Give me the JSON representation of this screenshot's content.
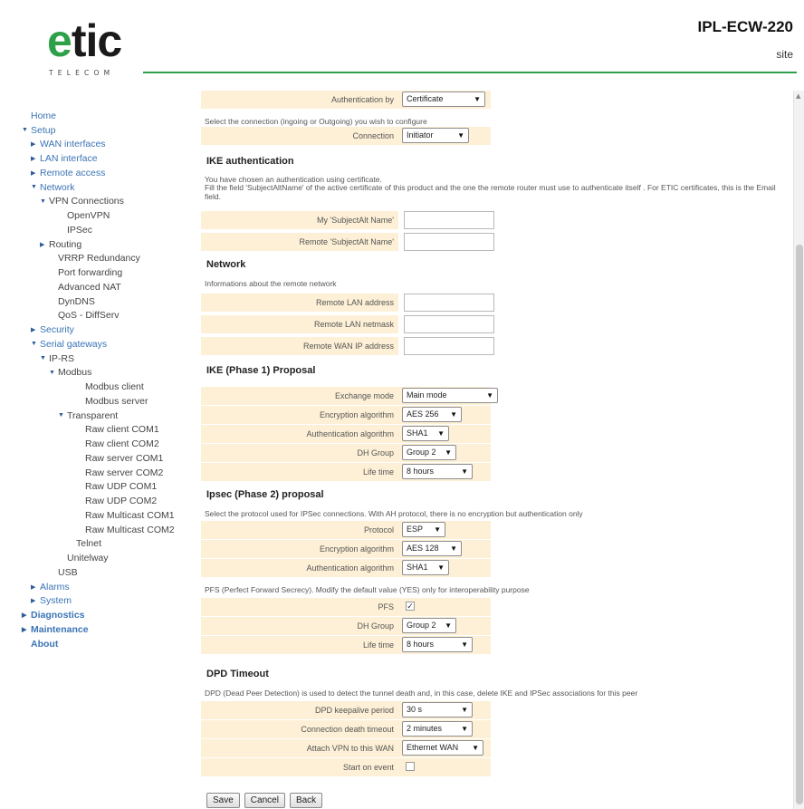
{
  "header": {
    "logo_main": "tic",
    "logo_e": "e",
    "logo_sub": "TELECOM",
    "product_title": "IPL-ECW-220",
    "product_sub": "site"
  },
  "sidebar": [
    {
      "label": "Home",
      "indent": 0,
      "tri": "",
      "cls": "link"
    },
    {
      "label": "Setup",
      "indent": 0,
      "tri": "▼",
      "cls": "link"
    },
    {
      "label": "WAN interfaces",
      "indent": 1,
      "tri": "▶",
      "cls": "link"
    },
    {
      "label": "LAN interface",
      "indent": 1,
      "tri": "▶",
      "cls": "link"
    },
    {
      "label": "Remote access",
      "indent": 1,
      "tri": "▶",
      "cls": "link"
    },
    {
      "label": "Network",
      "indent": 1,
      "tri": "▼",
      "cls": "link"
    },
    {
      "label": "VPN Connections",
      "indent": 2,
      "tri": "▼",
      "cls": ""
    },
    {
      "label": "OpenVPN",
      "indent": 4,
      "tri": "",
      "cls": ""
    },
    {
      "label": "IPSec",
      "indent": 4,
      "tri": "",
      "cls": ""
    },
    {
      "label": "Routing",
      "indent": 2,
      "tri": "▶",
      "cls": ""
    },
    {
      "label": "VRRP Redundancy",
      "indent": 3,
      "tri": "",
      "cls": ""
    },
    {
      "label": "Port forwarding",
      "indent": 3,
      "tri": "",
      "cls": ""
    },
    {
      "label": "Advanced NAT",
      "indent": 3,
      "tri": "",
      "cls": ""
    },
    {
      "label": "DynDNS",
      "indent": 3,
      "tri": "",
      "cls": ""
    },
    {
      "label": "QoS - DiffServ",
      "indent": 3,
      "tri": "",
      "cls": ""
    },
    {
      "label": "Security",
      "indent": 1,
      "tri": "▶",
      "cls": "link"
    },
    {
      "label": "Serial gateways",
      "indent": 1,
      "tri": "▼",
      "cls": "link"
    },
    {
      "label": "IP-RS",
      "indent": 2,
      "tri": "▼",
      "cls": ""
    },
    {
      "label": "Modbus",
      "indent": 3,
      "tri": "▼",
      "cls": ""
    },
    {
      "label": "Modbus client",
      "indent": 6,
      "tri": "",
      "cls": ""
    },
    {
      "label": "Modbus server",
      "indent": 6,
      "tri": "",
      "cls": ""
    },
    {
      "label": "Transparent",
      "indent": 4,
      "tri": "▼",
      "cls": ""
    },
    {
      "label": "Raw client COM1",
      "indent": 6,
      "tri": "",
      "cls": ""
    },
    {
      "label": "Raw client COM2",
      "indent": 6,
      "tri": "",
      "cls": ""
    },
    {
      "label": "Raw server COM1",
      "indent": 6,
      "tri": "",
      "cls": ""
    },
    {
      "label": "Raw server COM2",
      "indent": 6,
      "tri": "",
      "cls": ""
    },
    {
      "label": "Raw UDP COM1",
      "indent": 6,
      "tri": "",
      "cls": ""
    },
    {
      "label": "Raw UDP COM2",
      "indent": 6,
      "tri": "",
      "cls": ""
    },
    {
      "label": "Raw Multicast COM1",
      "indent": 6,
      "tri": "",
      "cls": ""
    },
    {
      "label": "Raw Multicast COM2",
      "indent": 6,
      "tri": "",
      "cls": ""
    },
    {
      "label": "Telnet",
      "indent": 5,
      "tri": "",
      "cls": ""
    },
    {
      "label": "Unitelway",
      "indent": 4,
      "tri": "",
      "cls": ""
    },
    {
      "label": "USB",
      "indent": 3,
      "tri": "",
      "cls": ""
    },
    {
      "label": "Alarms",
      "indent": 1,
      "tri": "▶",
      "cls": "link"
    },
    {
      "label": "System",
      "indent": 1,
      "tri": "▶",
      "cls": "link"
    },
    {
      "label": "Diagnostics",
      "indent": 0,
      "tri": "▶",
      "cls": "link bold"
    },
    {
      "label": "Maintenance",
      "indent": 0,
      "tri": "▶",
      "cls": "link bold"
    },
    {
      "label": "About",
      "indent": 0,
      "tri": "",
      "cls": "link bold"
    }
  ],
  "form": {
    "auth_by_label": "Authentication by",
    "auth_by_value": "Certificate",
    "connection_info": "Select the connection (ingoing or Outgoing) you wish to configure",
    "connection_label": "Connection",
    "connection_value": "Initiator",
    "ike_auth_title": "IKE authentication",
    "ike_auth_info_1": "You have chosen an authentication using certificate.",
    "ike_auth_info_2": "Fill the field 'SubjectAltName' of the active certificate of this product and the one the remote router must use to authenticate itself . For ETIC certificates, this is the Email field.",
    "my_san_label": "My 'SubjectAlt Name'",
    "remote_san_label": "Remote 'SubjectAlt Name'",
    "network_title": "Network",
    "network_info": "Informations about the remote network",
    "remote_lan_address_label": "Remote LAN address",
    "remote_lan_netmask_label": "Remote LAN netmask",
    "remote_wan_ip_label": "Remote WAN IP address",
    "ike_p1_title": "IKE (Phase 1) Proposal",
    "exchange_mode_label": "Exchange mode",
    "exchange_mode_value": "Main mode",
    "p1_enc_label": "Encryption algorithm",
    "p1_enc_value": "AES 256",
    "p1_auth_label": "Authentication algorithm",
    "p1_auth_value": "SHA1",
    "p1_dh_label": "DH Group",
    "p1_dh_value": "Group 2",
    "p1_life_label": "Life time",
    "p1_life_value": "8 hours",
    "ipsec_p2_title": "Ipsec (Phase 2) proposal",
    "ipsec_p2_info": "Select the protocol used for IPSec connections. With AH protocol, there is no encryption but authentication only",
    "protocol_label": "Protocol",
    "protocol_value": "ESP",
    "p2_enc_label": "Encryption algorithm",
    "p2_enc_value": "AES 128",
    "p2_auth_label": "Authentication algorithm",
    "p2_auth_value": "SHA1",
    "pfs_info": "PFS (Perfect Forward Secrecy). Modify the default value (YES) only for interoperability purpose",
    "pfs_label": "PFS",
    "pfs_check": "✓",
    "pfs_dh_label": "DH Group",
    "pfs_dh_value": "Group 2",
    "pfs_life_label": "Life time",
    "pfs_life_value": "8 hours",
    "dpd_title": "DPD Timeout",
    "dpd_info": "DPD (Dead Peer Detection) is used to detect the tunnel death and, in this case, delete IKE and IPSec associations for this peer",
    "dpd_period_label": "DPD keepalive period",
    "dpd_period_value": "30 s",
    "conn_death_label": "Connection death timeout",
    "conn_death_value": "2 minutes",
    "attach_vpn_label": "Attach VPN to this WAN",
    "attach_vpn_value": "Ethernet WAN",
    "start_event_label": "Start on event",
    "save_label": "Save",
    "cancel_label": "Cancel",
    "back_label": "Back"
  }
}
